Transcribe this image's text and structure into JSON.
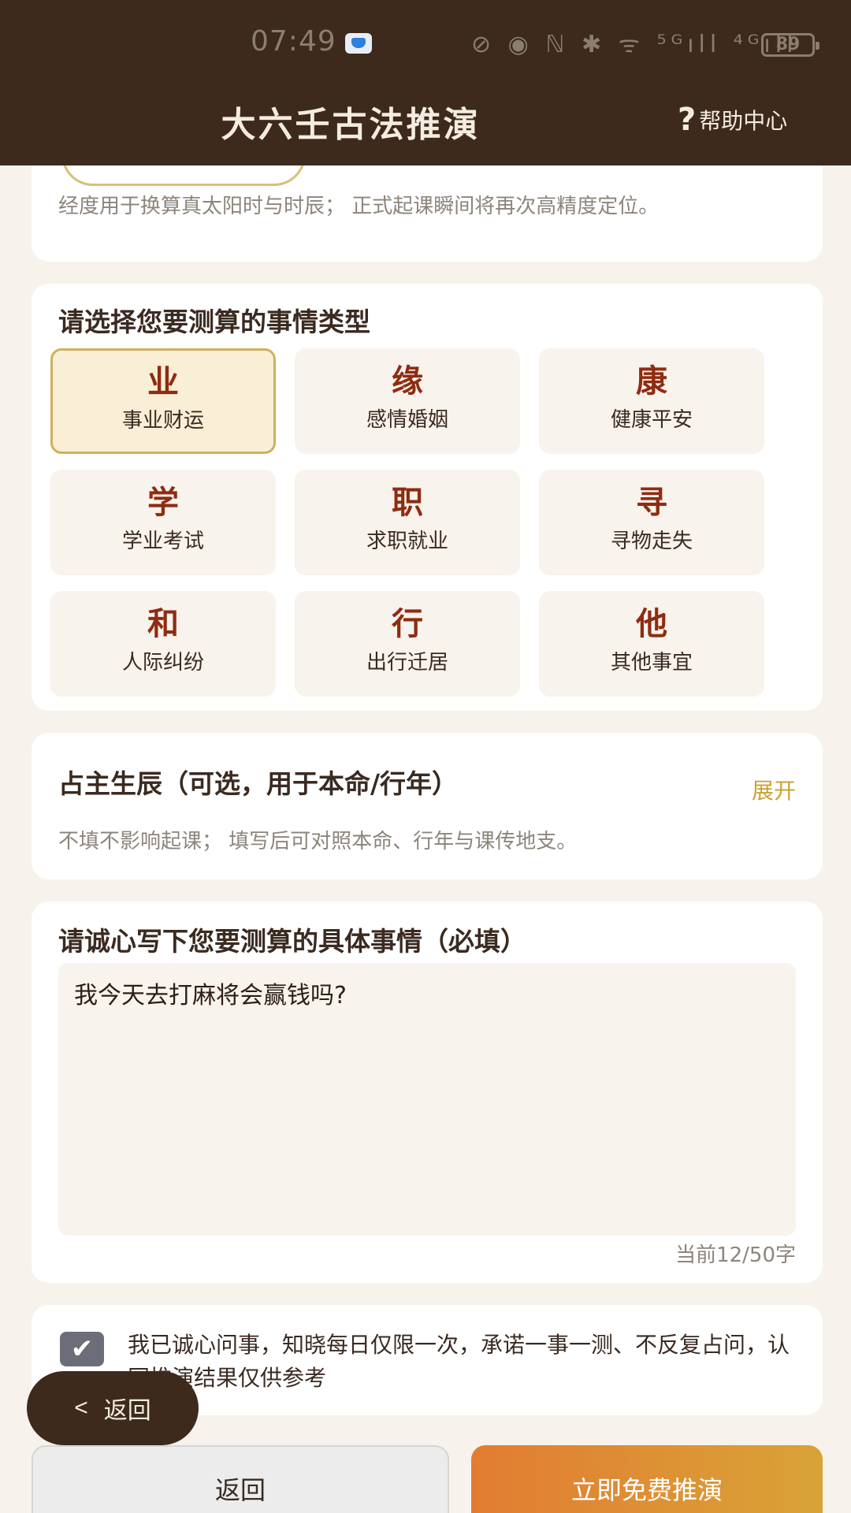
{
  "status_bar": {
    "time": "07:49",
    "icons": "⊘ ◉ ℕ ✱ ᯤ ⁵ᴳıll ⁴ᴳıll",
    "battery": "89"
  },
  "header": {
    "title": "大六壬古法推演",
    "help_label": "帮助中心",
    "help_icon": "?"
  },
  "location_card": {
    "hint": "经度用于换算真太阳时与时辰； 正式起课瞬间将再次高精度定位。"
  },
  "category_card": {
    "title": "请选择您要测算的事情类型",
    "selected_index": 0,
    "items": [
      {
        "char": "业",
        "label": "事业财运"
      },
      {
        "char": "缘",
        "label": "感情婚姻"
      },
      {
        "char": "康",
        "label": "健康平安"
      },
      {
        "char": "学",
        "label": "学业考试"
      },
      {
        "char": "职",
        "label": "求职就业"
      },
      {
        "char": "寻",
        "label": "寻物走失"
      },
      {
        "char": "和",
        "label": "人际纠纷"
      },
      {
        "char": "行",
        "label": "出行迁居"
      },
      {
        "char": "他",
        "label": "其他事宜"
      }
    ]
  },
  "birth_card": {
    "title": "占主生辰（可选，用于本命/行年）",
    "expand_label": "展开",
    "hint": "不填不影响起课； 填写后可对照本命、行年与课传地支。"
  },
  "question_card": {
    "title": "请诚心写下您要测算的具体事情（必填）",
    "value": "我今天去打麻将会赢钱吗?",
    "counter": "当前12/50字"
  },
  "agreement": {
    "checked": true,
    "text": "我已诚心问事，知晓每日仅限一次，承诺一事一测、不反复占问，认同推演结果仅供参考"
  },
  "floating_back": {
    "label": "返回",
    "icon": "chevron-left"
  },
  "footer": {
    "back_label": "返回",
    "submit_label": "立即免费推演"
  },
  "colors": {
    "header_bg": "#3d2a1c",
    "accent_gold": "#c9a233",
    "category_char": "#8e2c12",
    "submit_start": "#e27c32",
    "submit_end": "#d9a336"
  }
}
